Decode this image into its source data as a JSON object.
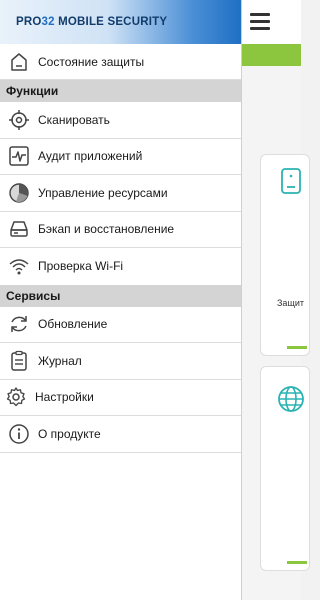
{
  "app": {
    "logo_prefix": "PRO",
    "logo_num": "32",
    "logo_suffix": " MOBILE SECURITY"
  },
  "colors": {
    "accent_green": "#8cc63f",
    "header_blue": "#1f6fc4",
    "icon_teal": "#2bb3b3"
  },
  "menu": {
    "status": {
      "label": "Состояние защиты",
      "icon": "shield-home-icon"
    },
    "functions_header": "Функции",
    "functions": [
      {
        "label": "Сканировать",
        "icon": "target-icon"
      },
      {
        "label": "Аудит приложений",
        "icon": "pulse-icon"
      },
      {
        "label": "Управление ресурсами",
        "icon": "pie-chart-icon"
      },
      {
        "label": "Бэкап и восстановление",
        "icon": "drive-icon"
      },
      {
        "label": "Проверка Wi-Fi",
        "icon": "wifi-icon"
      }
    ],
    "services_header": "Сервисы",
    "services": [
      {
        "label": "Обновление",
        "icon": "refresh-icon"
      },
      {
        "label": "Журнал",
        "icon": "clipboard-icon"
      },
      {
        "label": "Настройки",
        "icon": "gear-icon"
      },
      {
        "label": "О продукте",
        "icon": "info-icon"
      }
    ]
  },
  "background": {
    "card1_label": "Защит"
  }
}
